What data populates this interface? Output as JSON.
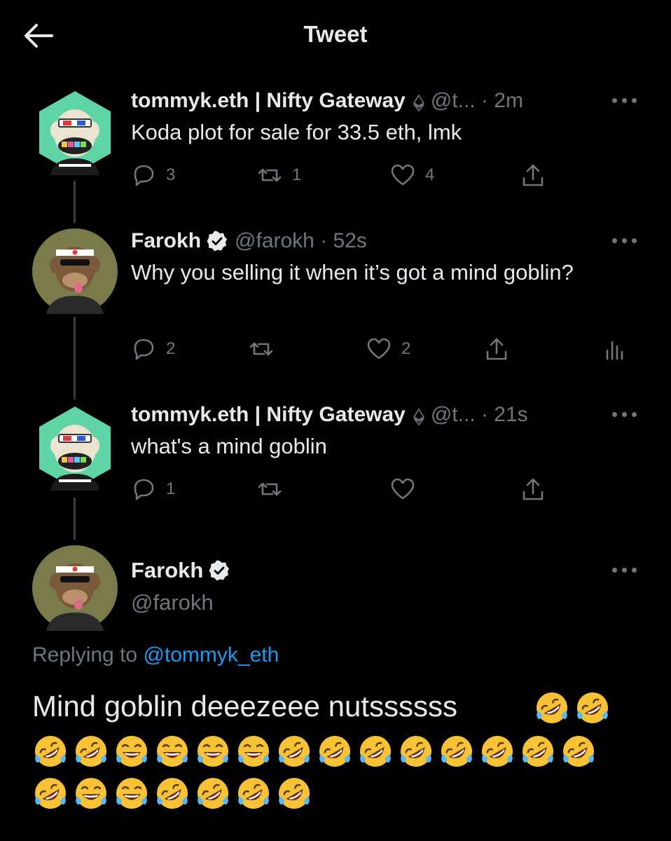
{
  "header": {
    "title": "Tweet"
  },
  "tweets": [
    {
      "name": "tommyk.eth | Nifty Gateway",
      "handle": "@t...",
      "time": "· 2m",
      "text": "Koda plot for sale for 33.5 eth, lmk",
      "replies": "3",
      "retweets": "1",
      "likes": "4"
    },
    {
      "name": "Farokh",
      "handle": "@farokh",
      "time": "· 52s",
      "text": "Why you selling it when it’s got a mind goblin?",
      "replies": "2",
      "retweets": "",
      "likes": "2"
    },
    {
      "name": "tommyk.eth | Nifty Gateway",
      "handle": "@t...",
      "time": "· 21s",
      "text": "what's a mind goblin",
      "replies": "1",
      "retweets": "",
      "likes": ""
    }
  ],
  "main": {
    "name": "Farokh",
    "handle": "@farokh",
    "replying_prefix": "Replying to",
    "replying_mention": "@tommyk_eth",
    "text": "Mind goblin deeezeee nutssssss",
    "emoji_rows": [
      [
        "rofl",
        "rofl"
      ],
      [
        "rofl",
        "rofl",
        "joy",
        "joy",
        "joy",
        "joy",
        "rofl",
        "rofl",
        "rofl",
        "rofl",
        "rofl",
        "rofl",
        "rofl",
        "rofl"
      ],
      [
        "rofl",
        "joy",
        "joy",
        "rofl",
        "rofl",
        "rofl",
        "rofl"
      ]
    ]
  },
  "colors": {
    "background": "#000000",
    "text": "#e7e9ea",
    "muted": "#71767b",
    "link": "#1d9bf0",
    "line": "#3a3d41"
  }
}
